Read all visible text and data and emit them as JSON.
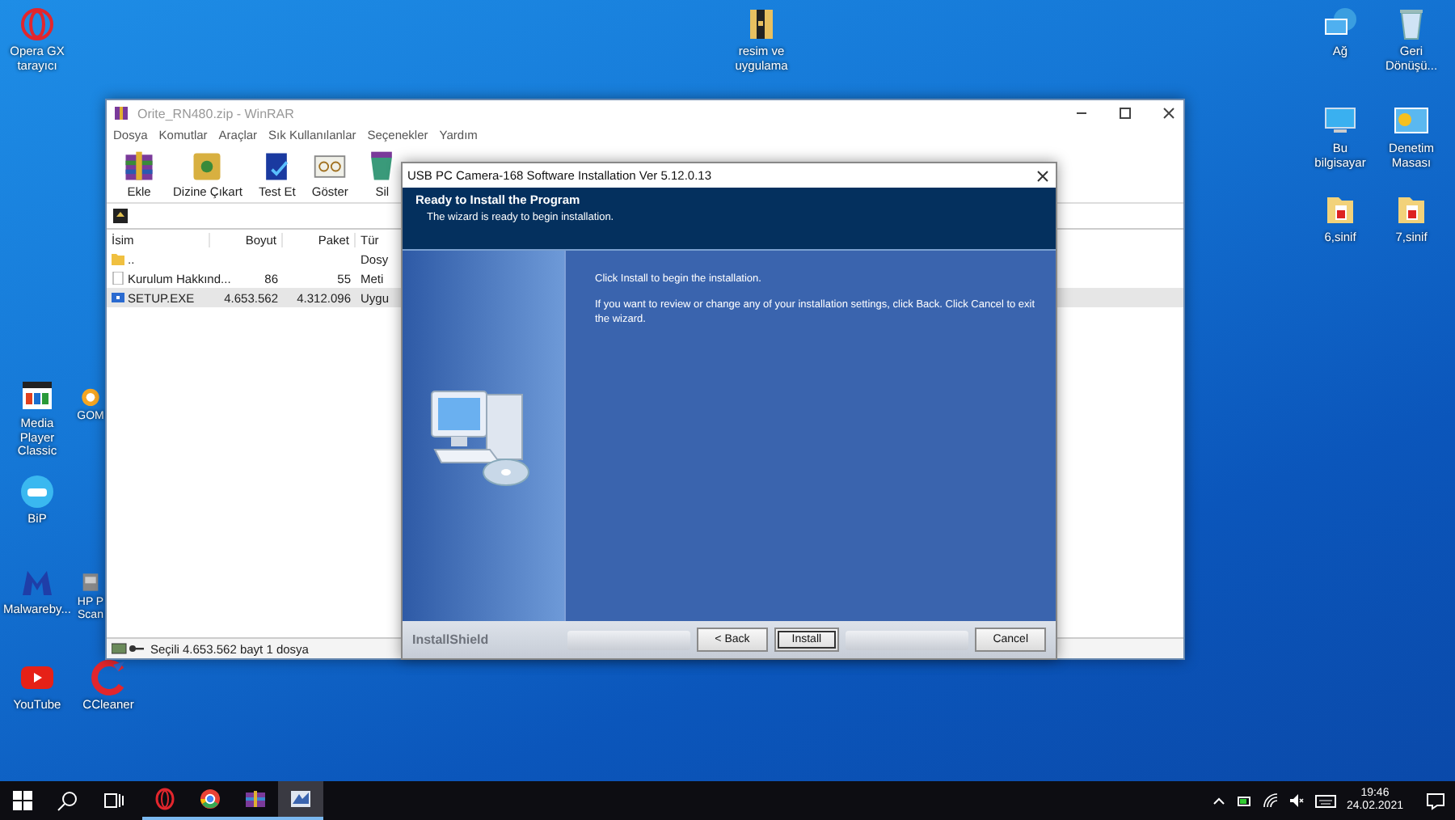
{
  "desktop_icons_left": [
    {
      "label": "Opera GX tarayıcı"
    },
    {
      "label": "Media Player Classic"
    },
    {
      "label": "GOM"
    },
    {
      "label": "BiP"
    },
    {
      "label": "Malwareby..."
    },
    {
      "label": "HP P Scan"
    },
    {
      "label": "YouTube"
    },
    {
      "label": "CCleaner"
    }
  ],
  "desktop_icons_right": [
    {
      "label": "resim ve uygulama"
    },
    {
      "label": "Ağ"
    },
    {
      "label": "Geri Dönüşü..."
    },
    {
      "label": "Bu bilgisayar"
    },
    {
      "label": "Denetim Masası"
    },
    {
      "label": "6,sinif"
    },
    {
      "label": "7,sinif"
    }
  ],
  "winrar": {
    "title": "Orite_RN480.zip - WinRAR",
    "menu": [
      "Dosya",
      "Komutlar",
      "Araçlar",
      "Sık Kullanılanlar",
      "Seçenekler",
      "Yardım"
    ],
    "toolbar": [
      "Ekle",
      "Dizine Çıkart",
      "Test Et",
      "Göster",
      "Sil"
    ],
    "columns": [
      "İsim",
      "Boyut",
      "Paket",
      "Tür"
    ],
    "rows": [
      {
        "kind": "folder",
        "name": "..",
        "size": "",
        "packed": "",
        "type": "Dosy",
        "selected": false
      },
      {
        "kind": "text",
        "name": "Kurulum Hakkınd...",
        "size": "86",
        "packed": "55",
        "type": "Meti",
        "selected": false
      },
      {
        "kind": "exe",
        "name": "SETUP.EXE",
        "size": "4.653.562",
        "packed": "4.312.096",
        "type": "Uygu",
        "selected": true
      }
    ],
    "status": "Seçili 4.653.562 bayt 1 dosya"
  },
  "installer": {
    "title": "USB PC Camera-168 Software Installation Ver 5.12.0.13",
    "heading": "Ready to Install the Program",
    "subheading": "The wizard is ready to begin installation.",
    "paragraphs": [
      "Click Install to begin the installation.",
      "If you want to review or change any of your installation settings, click Back. Click Cancel to exit the wizard."
    ],
    "brand": "InstallShield",
    "buttons": [
      {
        "label": "< Back",
        "focused": false
      },
      {
        "label": "Install",
        "focused": true
      },
      {
        "label": "Cancel",
        "focused": false
      }
    ]
  },
  "taskbar": {
    "apps": [
      {
        "selected": false
      },
      {
        "selected": false
      },
      {
        "selected": false
      },
      {
        "selected": true
      }
    ],
    "time": "19:46",
    "date": "24.02.2021"
  }
}
